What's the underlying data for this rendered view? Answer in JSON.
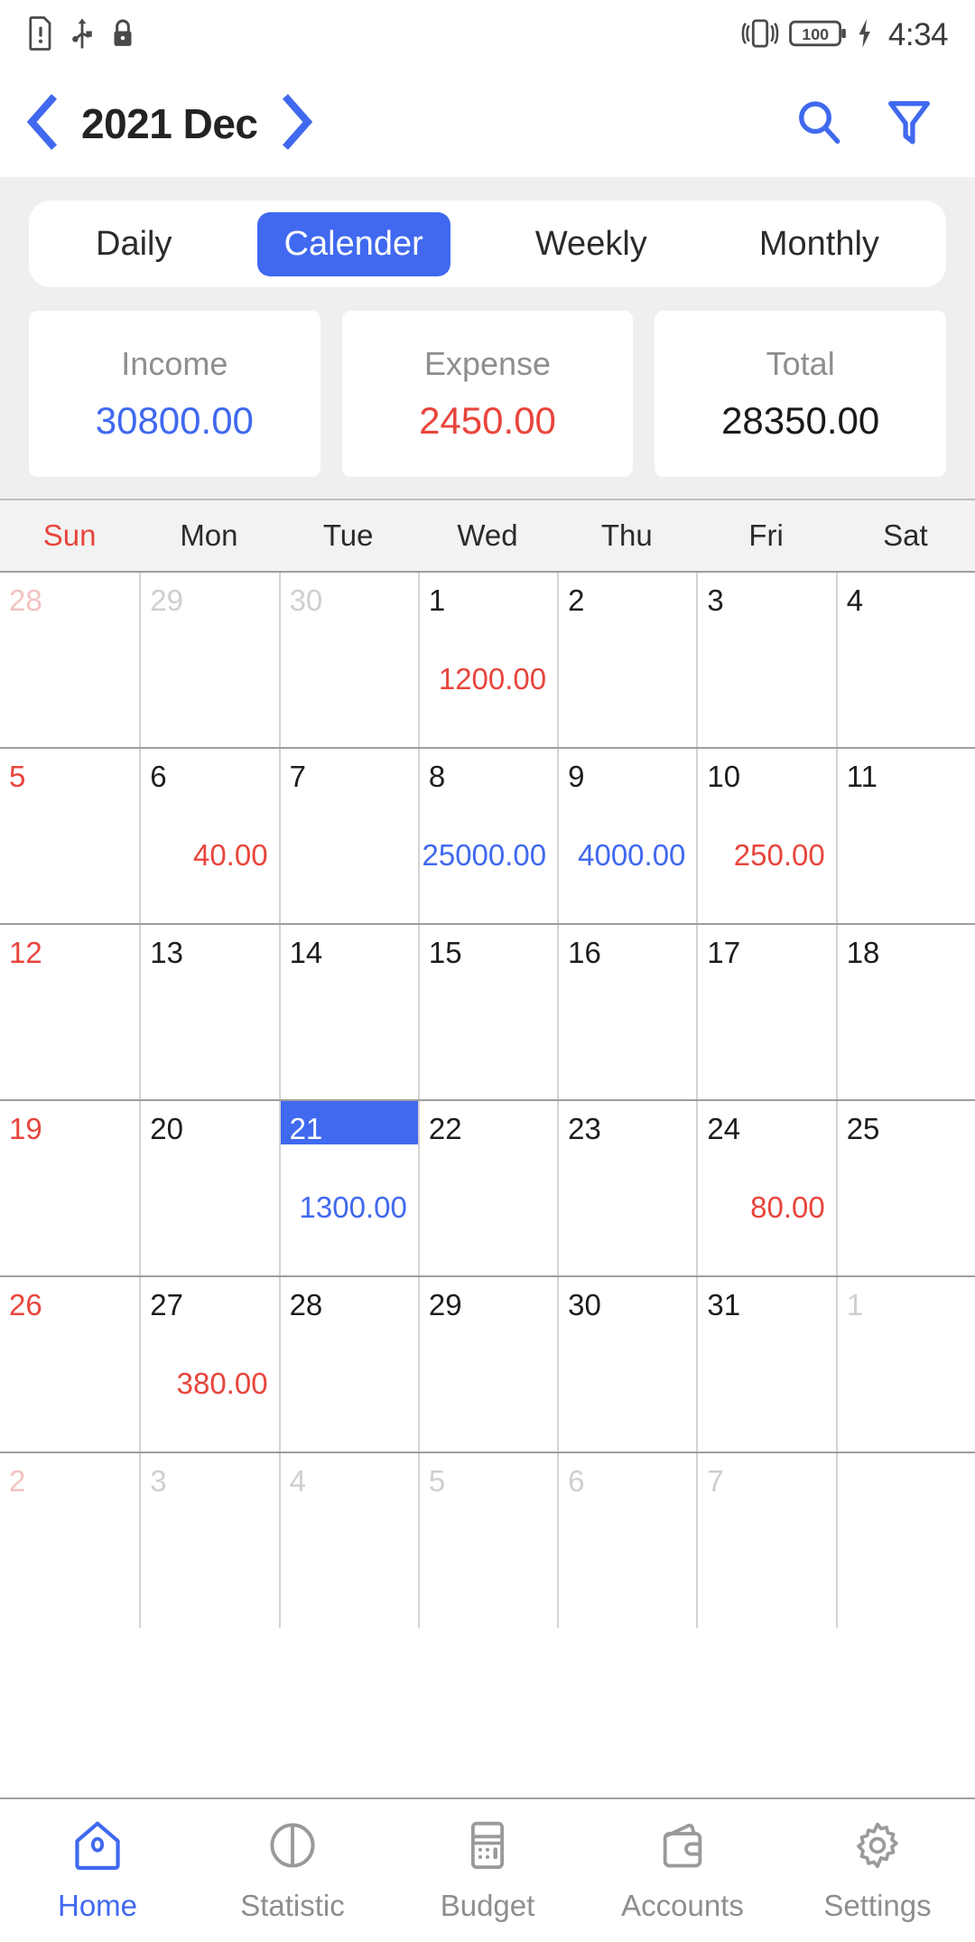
{
  "status_bar": {
    "left_icons": [
      "sim-alert-icon",
      "usb-icon",
      "lock-icon"
    ],
    "right_icons": [
      "vibrate-icon",
      "battery-icon",
      "charging-bolt-icon"
    ],
    "battery_level": "100",
    "time": "4:34"
  },
  "top_bar": {
    "prev_label": "‹",
    "title": "2021 Dec",
    "next_label": "›",
    "search_icon": "search-icon",
    "filter_icon": "filter-icon"
  },
  "tabs": [
    {
      "label": "Daily",
      "active": false
    },
    {
      "label": "Calender",
      "active": true
    },
    {
      "label": "Weekly",
      "active": false
    },
    {
      "label": "Monthly",
      "active": false
    }
  ],
  "summary": {
    "income": {
      "label": "Income",
      "value": "30800.00"
    },
    "expense": {
      "label": "Expense",
      "value": "2450.00"
    },
    "total": {
      "label": "Total",
      "value": "28350.00"
    }
  },
  "weekdays": [
    "Sun",
    "Mon",
    "Tue",
    "Wed",
    "Thu",
    "Fri",
    "Sat"
  ],
  "calendar": {
    "weeks": [
      [
        {
          "day": "28",
          "out": true,
          "amount": null,
          "type": null
        },
        {
          "day": "29",
          "out": true,
          "amount": null,
          "type": null
        },
        {
          "day": "30",
          "out": true,
          "amount": null,
          "type": null
        },
        {
          "day": "1",
          "out": false,
          "amount": "1200.00",
          "type": "exp"
        },
        {
          "day": "2",
          "out": false,
          "amount": null,
          "type": null
        },
        {
          "day": "3",
          "out": false,
          "amount": null,
          "type": null
        },
        {
          "day": "4",
          "out": false,
          "amount": null,
          "type": null
        }
      ],
      [
        {
          "day": "5",
          "out": false,
          "amount": null,
          "type": null
        },
        {
          "day": "6",
          "out": false,
          "amount": "40.00",
          "type": "exp"
        },
        {
          "day": "7",
          "out": false,
          "amount": null,
          "type": null
        },
        {
          "day": "8",
          "out": false,
          "amount": "25000.00",
          "type": "inc"
        },
        {
          "day": "9",
          "out": false,
          "amount": "4000.00",
          "type": "inc"
        },
        {
          "day": "10",
          "out": false,
          "amount": "250.00",
          "type": "exp"
        },
        {
          "day": "11",
          "out": false,
          "amount": null,
          "type": null
        }
      ],
      [
        {
          "day": "12",
          "out": false,
          "amount": null,
          "type": null
        },
        {
          "day": "13",
          "out": false,
          "amount": null,
          "type": null
        },
        {
          "day": "14",
          "out": false,
          "amount": null,
          "type": null
        },
        {
          "day": "15",
          "out": false,
          "amount": null,
          "type": null
        },
        {
          "day": "16",
          "out": false,
          "amount": null,
          "type": null
        },
        {
          "day": "17",
          "out": false,
          "amount": null,
          "type": null
        },
        {
          "day": "18",
          "out": false,
          "amount": null,
          "type": null
        }
      ],
      [
        {
          "day": "19",
          "out": false,
          "amount": null,
          "type": null
        },
        {
          "day": "20",
          "out": false,
          "amount": null,
          "type": null
        },
        {
          "day": "21",
          "out": false,
          "amount": "1300.00",
          "type": "inc",
          "selected": true
        },
        {
          "day": "22",
          "out": false,
          "amount": null,
          "type": null
        },
        {
          "day": "23",
          "out": false,
          "amount": null,
          "type": null
        },
        {
          "day": "24",
          "out": false,
          "amount": "80.00",
          "type": "exp"
        },
        {
          "day": "25",
          "out": false,
          "amount": null,
          "type": null
        }
      ],
      [
        {
          "day": "26",
          "out": false,
          "amount": null,
          "type": null
        },
        {
          "day": "27",
          "out": false,
          "amount": "380.00",
          "type": "exp"
        },
        {
          "day": "28",
          "out": false,
          "amount": null,
          "type": null
        },
        {
          "day": "29",
          "out": false,
          "amount": null,
          "type": null
        },
        {
          "day": "30",
          "out": false,
          "amount": null,
          "type": null
        },
        {
          "day": "31",
          "out": false,
          "amount": null,
          "type": null
        },
        {
          "day": "1",
          "out": true,
          "amount": null,
          "type": null
        }
      ],
      [
        {
          "day": "2",
          "out": true,
          "amount": null,
          "type": null
        },
        {
          "day": "3",
          "out": true,
          "amount": null,
          "type": null
        },
        {
          "day": "4",
          "out": true,
          "amount": null,
          "type": null
        },
        {
          "day": "5",
          "out": true,
          "amount": null,
          "type": null
        },
        {
          "day": "6",
          "out": true,
          "amount": null,
          "type": null
        },
        {
          "day": "7",
          "out": true,
          "amount": null,
          "type": null
        },
        {
          "day": "",
          "out": true,
          "amount": null,
          "type": null
        }
      ]
    ]
  },
  "fab": {
    "label": "+",
    "icon": "plus-icon"
  },
  "bottom_nav": [
    {
      "label": "Home",
      "icon": "home-icon",
      "active": true
    },
    {
      "label": "Statistic",
      "icon": "pie-chart-icon",
      "active": false
    },
    {
      "label": "Budget",
      "icon": "calculator-icon",
      "active": false
    },
    {
      "label": "Accounts",
      "icon": "wallet-icon",
      "active": false
    },
    {
      "label": "Settings",
      "icon": "gear-icon",
      "active": false
    }
  ],
  "colors": {
    "accent": "#4069ef",
    "expense": "#e8453c",
    "income": "#4069ef",
    "panel_bg": "#efefef"
  }
}
